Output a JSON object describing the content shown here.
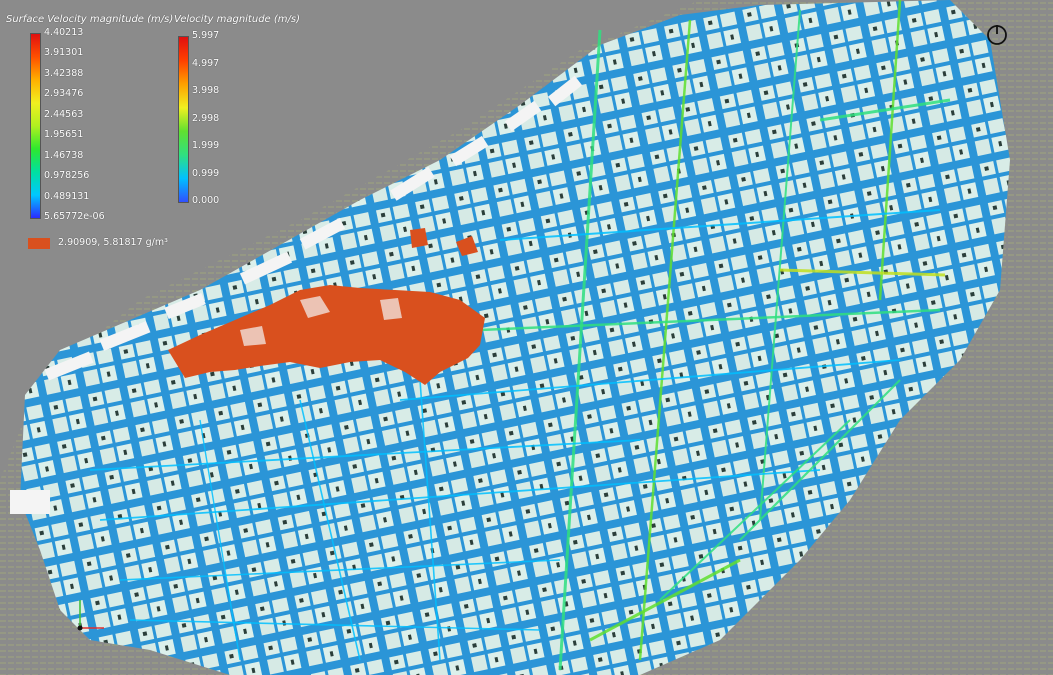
{
  "chart_data": [
    {
      "type": "heatmap",
      "title": "Surface Velocity magnitude (m/s)",
      "colormap": [
        "#2b2bff",
        "#00c8ff",
        "#00e0a0",
        "#2ee82e",
        "#b0f020",
        "#f0f020",
        "#ffb000",
        "#ff5000",
        "#e01010"
      ],
      "range": [
        5.65772e-06,
        4.40213
      ],
      "ticks": [
        "4.40213",
        "3.91301",
        "3.42388",
        "2.93476",
        "2.44563",
        "1.95651",
        "1.46738",
        "0.978256",
        "0.489131",
        "5.65772e-06"
      ]
    },
    {
      "type": "heatmap",
      "title": "Velocity magnitude (m/s)",
      "colormap": [
        "#3050ff",
        "#00c0ff",
        "#30e080",
        "#60e030",
        "#f0f020",
        "#ffa000",
        "#ff4000",
        "#e01010"
      ],
      "range": [
        0.0,
        5.997
      ],
      "ticks": [
        "5.997",
        "4.997",
        "3.998",
        "2.998",
        "1.999",
        "0.999",
        "0.000"
      ]
    }
  ],
  "isosurface": {
    "label": "2.90909, 5.81817 g/m³",
    "color": "#d9501e"
  },
  "colors": {
    "background": "#8b8b8b",
    "building": "#f4f4f4",
    "plume": "#d9501e"
  },
  "icons": {
    "power": "power-icon",
    "axes": "orientation-axes-icon"
  }
}
